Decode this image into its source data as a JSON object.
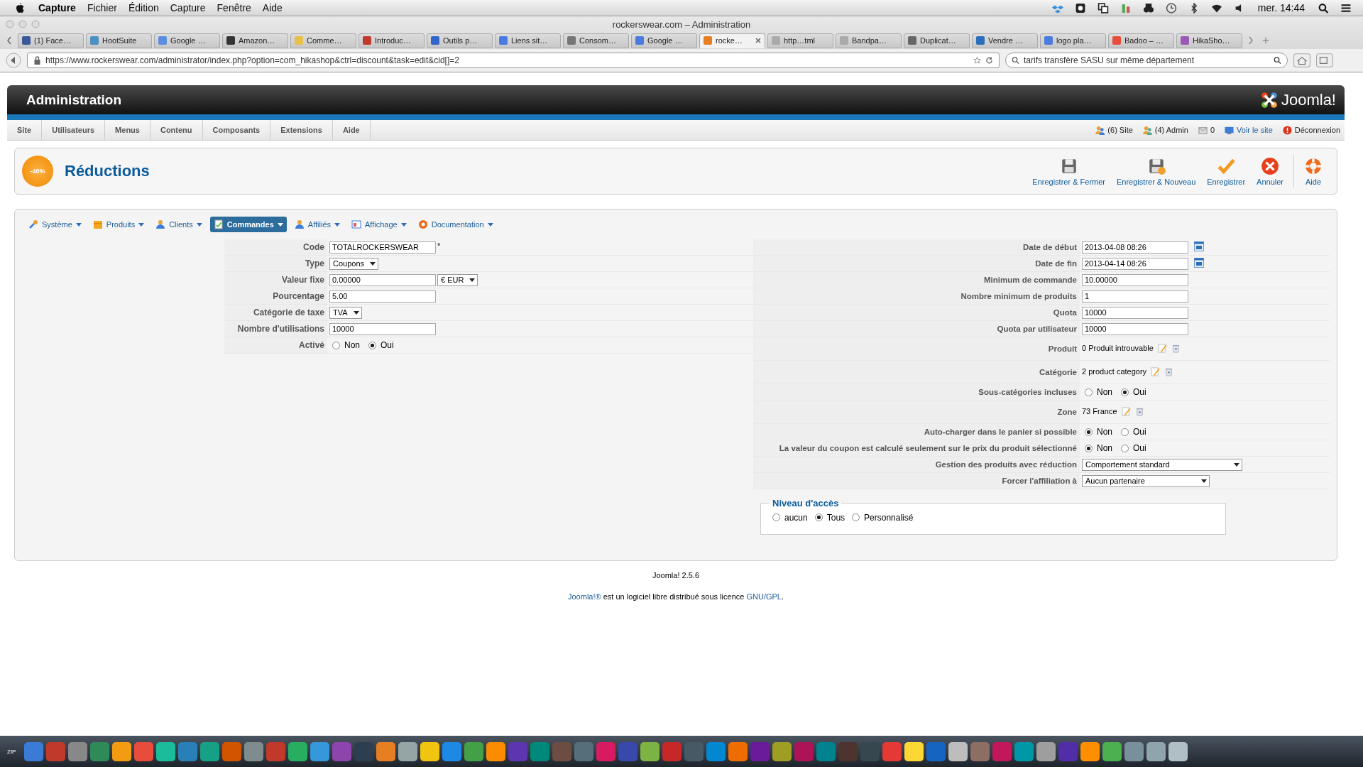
{
  "menubar": {
    "app": "Capture",
    "menus": [
      "Fichier",
      "Édition",
      "Capture",
      "Fenêtre",
      "Aide"
    ],
    "clock": "mer. 14:44"
  },
  "window": {
    "title": "rockerswear.com – Administration"
  },
  "tabs": [
    {
      "label": "(1) Face…",
      "selected": false
    },
    {
      "label": "HootSuite",
      "selected": false
    },
    {
      "label": "Google …",
      "selected": false
    },
    {
      "label": "Amazon…",
      "selected": false
    },
    {
      "label": "Comme…",
      "selected": false
    },
    {
      "label": "Introduc…",
      "selected": false
    },
    {
      "label": "Outils p…",
      "selected": false
    },
    {
      "label": "Liens sit…",
      "selected": false
    },
    {
      "label": "Consom…",
      "selected": false
    },
    {
      "label": "Google …",
      "selected": false
    },
    {
      "label": "rocke…",
      "selected": true
    },
    {
      "label": "http…tml",
      "selected": false
    },
    {
      "label": "Bandpa…",
      "selected": false
    },
    {
      "label": "Duplicat…",
      "selected": false
    },
    {
      "label": "Vendre …",
      "selected": false
    },
    {
      "label": "logo pla…",
      "selected": false
    },
    {
      "label": "Badoo – …",
      "selected": false
    },
    {
      "label": "HikaSho…",
      "selected": false
    }
  ],
  "address_bar": {
    "url": "https://www.rockerswear.com/administrator/index.php?option=com_hikashop&ctrl=discount&task=edit&cid[]=2"
  },
  "search": {
    "value": "tarifs transfère SASU sur même département"
  },
  "admin": {
    "title": "Administration",
    "logo_text": "Joomla!"
  },
  "nav": [
    "Site",
    "Utilisateurs",
    "Menus",
    "Contenu",
    "Composants",
    "Extensions",
    "Aide"
  ],
  "status": [
    {
      "kind": "site",
      "text": "(6) Site"
    },
    {
      "kind": "admin",
      "text": "(4) Admin"
    },
    {
      "kind": "messages",
      "text": "0"
    },
    {
      "kind": "view",
      "text": "Voir le site"
    },
    {
      "kind": "logout",
      "text": "Déconnexion"
    }
  ],
  "page": {
    "title": "Réductions",
    "badge": "-40%"
  },
  "toolbar": [
    {
      "kind": "save-close",
      "label": "Enregistrer & Fermer"
    },
    {
      "kind": "save-new",
      "label": "Enregistrer & Nouveau"
    },
    {
      "kind": "save",
      "label": "Enregistrer"
    },
    {
      "kind": "cancel",
      "label": "Annuler"
    },
    {
      "kind": "help",
      "label": "Aide"
    }
  ],
  "submenu": [
    {
      "kind": "system",
      "label": "Système",
      "selected": false
    },
    {
      "kind": "products",
      "label": "Produits",
      "selected": false
    },
    {
      "kind": "customers",
      "label": "Clients",
      "selected": false
    },
    {
      "kind": "orders",
      "label": "Commandes",
      "selected": true
    },
    {
      "kind": "affiliates",
      "label": "Affiliés",
      "selected": false
    },
    {
      "kind": "display",
      "label": "Affichage",
      "selected": false
    },
    {
      "kind": "docs",
      "label": "Documentation",
      "selected": false
    }
  ],
  "form_left": [
    {
      "kind": "text",
      "label": "Code",
      "value": "TOTALROCKERSWEAR",
      "required": "*"
    },
    {
      "kind": "select",
      "label": "Type",
      "value": "Coupons"
    },
    {
      "kind": "text_select",
      "label": "Valeur fixe",
      "value": "0.00000",
      "unit": "€ EUR"
    },
    {
      "kind": "text",
      "label": "Pourcentage",
      "value": "5.00"
    },
    {
      "kind": "select",
      "label": "Catégorie de taxe",
      "value": "TVA"
    },
    {
      "kind": "text",
      "label": "Nombre d'utilisations",
      "value": "10000"
    },
    {
      "kind": "radio",
      "label": "Activé",
      "options": [
        {
          "label": "Non",
          "selected": false
        },
        {
          "label": "Oui",
          "selected": true
        }
      ]
    }
  ],
  "form_right": [
    {
      "kind": "date",
      "label": "Date de début",
      "value": "2013-04-08 08:26"
    },
    {
      "kind": "date",
      "label": "Date de fin",
      "value": "2013-04-14 08:26"
    },
    {
      "kind": "text",
      "label": "Minimum de commande",
      "value": "10.00000"
    },
    {
      "kind": "text",
      "label": "Nombre minimum de produits",
      "value": "1"
    },
    {
      "kind": "text",
      "label": "Quota",
      "value": "10000"
    },
    {
      "kind": "text",
      "label": "Quota par utilisateur",
      "value": "10000"
    },
    {
      "kind": "items",
      "label": "Produit",
      "value": "0 Produit introuvable"
    },
    {
      "kind": "items",
      "label": "Catégorie",
      "value": "2 product category"
    },
    {
      "kind": "radio",
      "label": "Sous-catégories incluses",
      "options": [
        {
          "label": "Non",
          "selected": false
        },
        {
          "label": "Oui",
          "selected": true
        }
      ]
    },
    {
      "kind": "items",
      "label": "Zone",
      "value": "73 France"
    },
    {
      "kind": "radio",
      "label": "Auto-charger dans le panier si possible",
      "options": [
        {
          "label": "Non",
          "selected": true
        },
        {
          "label": "Oui",
          "selected": false
        }
      ]
    },
    {
      "kind": "radio",
      "label": "La valeur du coupon est calculé seulement sur le prix du produit sélectionné",
      "options": [
        {
          "label": "Non",
          "selected": true
        },
        {
          "label": "Oui",
          "selected": false
        }
      ]
    },
    {
      "kind": "select",
      "label": "Gestion des produits avec réduction",
      "value": "Comportement standard"
    },
    {
      "kind": "select",
      "label": "Forcer l'affiliation à",
      "value": "Aucun partenaire"
    }
  ],
  "access": {
    "legend": "Niveau d'accès",
    "options": [
      {
        "label": "aucun",
        "selected": false
      },
      {
        "label": "Tous",
        "selected": true
      },
      {
        "label": "Personnalisé",
        "selected": false
      }
    ]
  },
  "footer": {
    "version": "Joomla! 2.5.6",
    "link": "Joomla!®",
    "text": "est un logiciel libre distribué sous licence",
    "license": "GNU/GPL",
    "end": "."
  },
  "dock": {
    "label": "ZIP"
  }
}
